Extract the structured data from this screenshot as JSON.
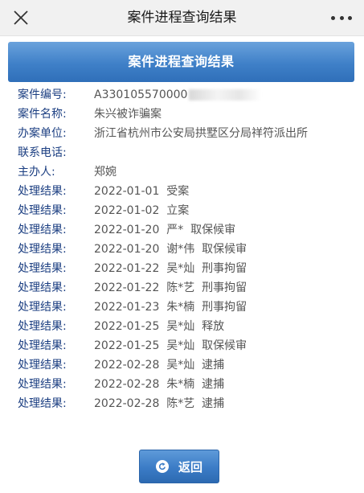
{
  "topbar": {
    "title": "案件进程查询结果",
    "close_icon": "close-icon",
    "more_icon": "more-dots-icon"
  },
  "banner": {
    "title": "案件进程查询结果"
  },
  "case_info": [
    {
      "label": "案件编号:",
      "value": "A330105570000"
    },
    {
      "label": "案件名称:",
      "value": "朱兴被诈骗案"
    },
    {
      "label": "办案单位:",
      "value": "浙江省杭州市公安局拱墅区分局祥符派出所"
    },
    {
      "label": "联系电话:",
      "value": ""
    },
    {
      "label": "主办人:",
      "value": "郑婉"
    }
  ],
  "results": [
    {
      "label": "处理结果:",
      "value": "2022-01-01  受案"
    },
    {
      "label": "处理结果:",
      "value": "2022-01-02  立案"
    },
    {
      "label": "处理结果:",
      "value": "2022-01-20  严*  取保候审"
    },
    {
      "label": "处理结果:",
      "value": "2022-01-20  谢*伟  取保候审"
    },
    {
      "label": "处理结果:",
      "value": "2022-01-22  吴*灿  刑事拘留"
    },
    {
      "label": "处理结果:",
      "value": "2022-01-22  陈*艺  刑事拘留"
    },
    {
      "label": "处理结果:",
      "value": "2022-01-23  朱*楠  刑事拘留"
    },
    {
      "label": "处理结果:",
      "value": "2022-01-25  吴*灿  释放"
    },
    {
      "label": "处理结果:",
      "value": "2022-01-25  吴*灿  取保候审"
    },
    {
      "label": "处理结果:",
      "value": "2022-02-28  吴*灿  逮捕"
    },
    {
      "label": "处理结果:",
      "value": "2022-02-28  朱*楠  逮捕"
    },
    {
      "label": "处理结果:",
      "value": "2022-02-28  陈*艺  逮捕"
    }
  ],
  "back_button": {
    "label": "返回",
    "icon": "back-arrow-icon"
  },
  "colors": {
    "label": "#1c3f82",
    "value": "#555555",
    "banner": "#3f80c8"
  }
}
